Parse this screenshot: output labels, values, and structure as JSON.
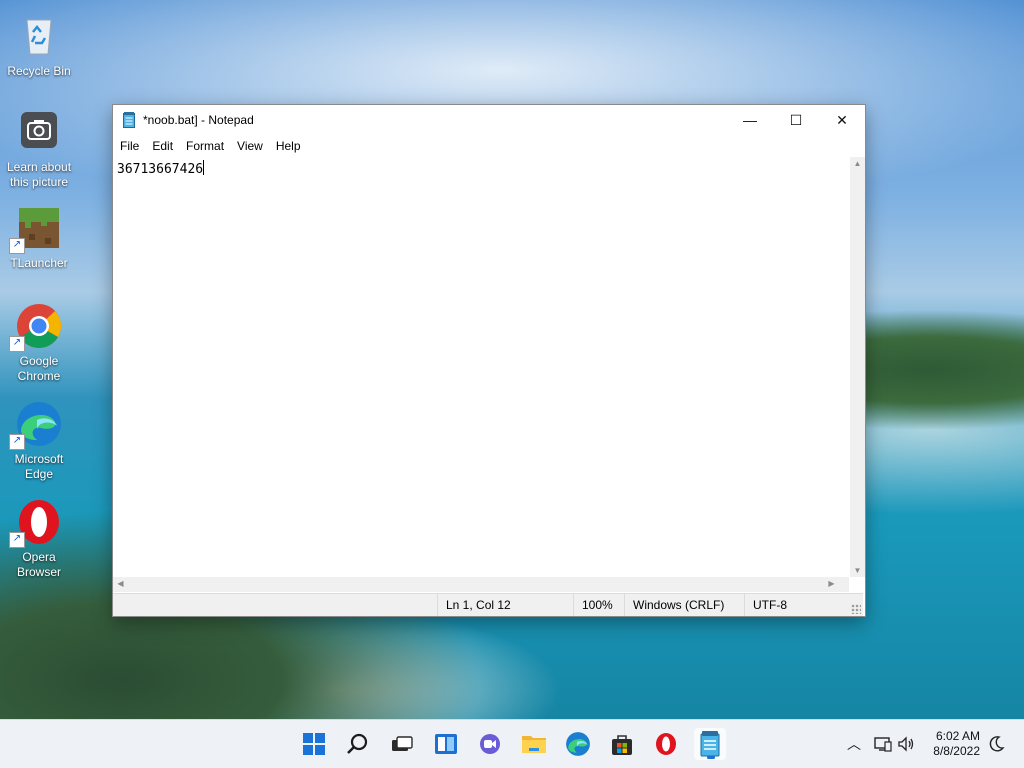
{
  "desktop": {
    "icons": [
      {
        "label": "Recycle Bin",
        "icon": "recycle-bin-icon"
      },
      {
        "label": "Learn about this picture",
        "icon": "camera-icon"
      },
      {
        "label": "TLauncher",
        "icon": "minecraft-block-icon"
      },
      {
        "label": "Google Chrome",
        "icon": "chrome-icon"
      },
      {
        "label": "Microsoft Edge",
        "icon": "edge-icon"
      },
      {
        "label": "Opera Browser",
        "icon": "opera-icon"
      }
    ]
  },
  "notepad": {
    "title": "*noob.bat] - Notepad",
    "menu": [
      "File",
      "Edit",
      "Format",
      "View",
      "Help"
    ],
    "content": "36713667426",
    "status": {
      "position": "Ln 1, Col 12",
      "zoom": "100%",
      "line_endings": "Windows (CRLF)",
      "encoding": "UTF-8"
    },
    "controls": {
      "minimize": "—",
      "maximize": "☐",
      "close": "✕"
    }
  },
  "taskbar": {
    "apps": [
      "start-icon",
      "search-icon",
      "task-view-icon",
      "widgets-icon",
      "chat-icon",
      "file-explorer-icon",
      "edge-icon",
      "store-icon",
      "opera-icon",
      "notepad-icon"
    ],
    "active_app": "notepad-icon",
    "clock": {
      "time": "6:02 AM",
      "date": "8/8/2022"
    },
    "tray": [
      "chevron-up-icon",
      "network-icon",
      "volume-icon",
      "notification-icon"
    ]
  },
  "colors": {
    "accent": "#1f6fd6",
    "taskbar": "#eef1f6"
  }
}
